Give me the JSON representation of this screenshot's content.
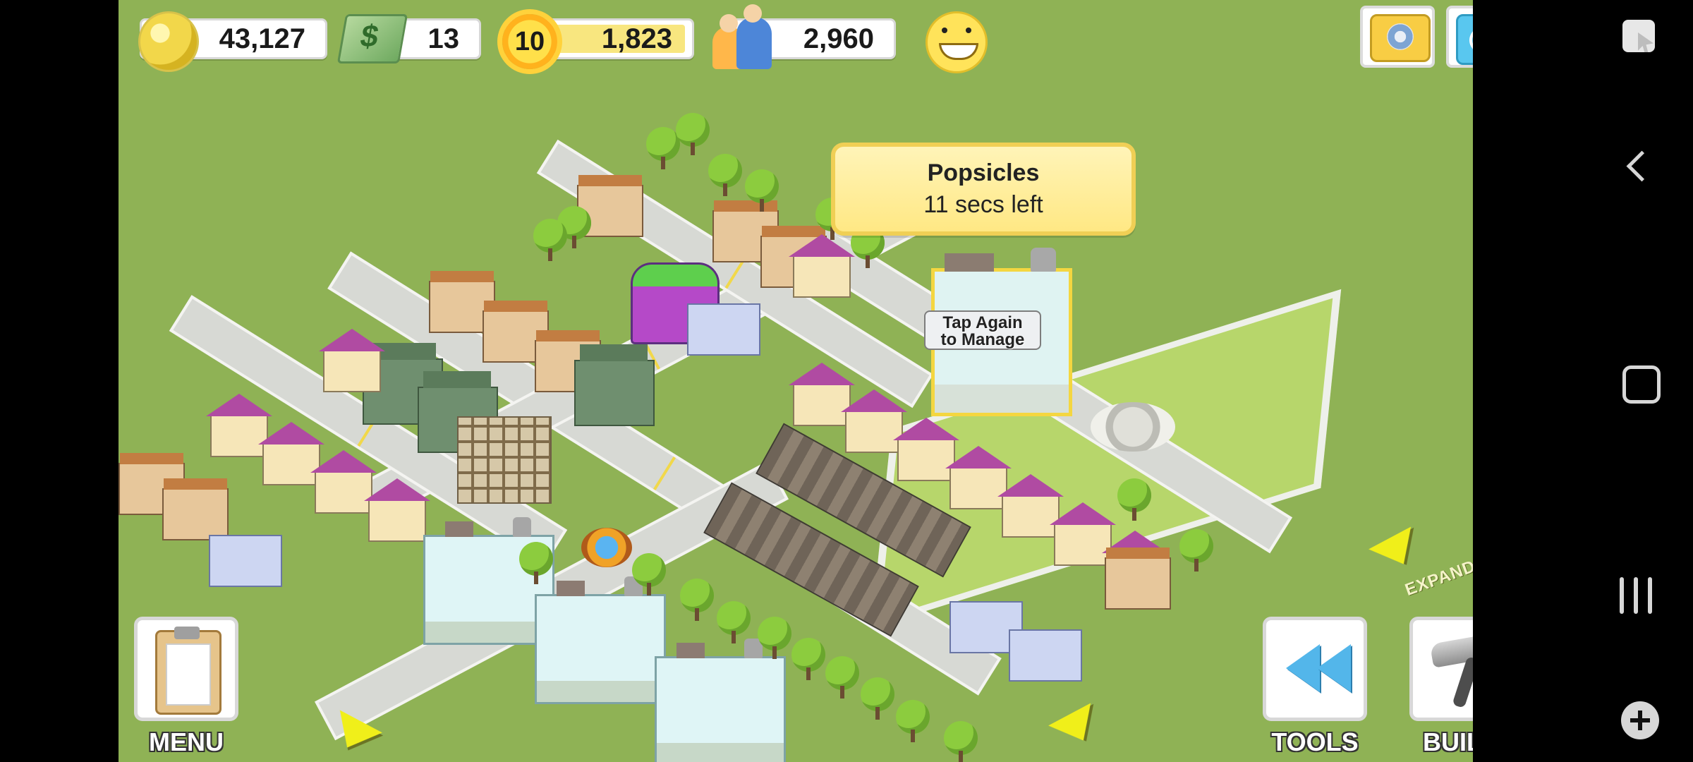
{
  "hud": {
    "coins": "43,127",
    "cash": "13",
    "level": "10",
    "xp": "1,823",
    "population": "2,960"
  },
  "tooltip": {
    "title": "Popsicles",
    "subtitle": "11 secs left"
  },
  "building_label": {
    "line1": "Tap Again",
    "line2": "to Manage"
  },
  "buttons": {
    "menu": "MENU",
    "tools": "TOOLS",
    "build": "BUILD"
  },
  "map": {
    "expand_label": "EXPAND"
  },
  "icons": {
    "coin": "coin-icon",
    "cash": "cash-icon",
    "level": "sun-icon",
    "population": "people-icon",
    "happiness": "smiley-icon",
    "camera": "camera-icon",
    "share": "share-icon",
    "menu": "clipboard-icon",
    "tools": "rewind-icon",
    "build": "hammer-icon"
  },
  "colors": {
    "grass": "#8fb255",
    "tooltip_bg": "#ffe884",
    "accent_yellow": "#f0ef1a",
    "ui_blue": "#59c7ef"
  }
}
